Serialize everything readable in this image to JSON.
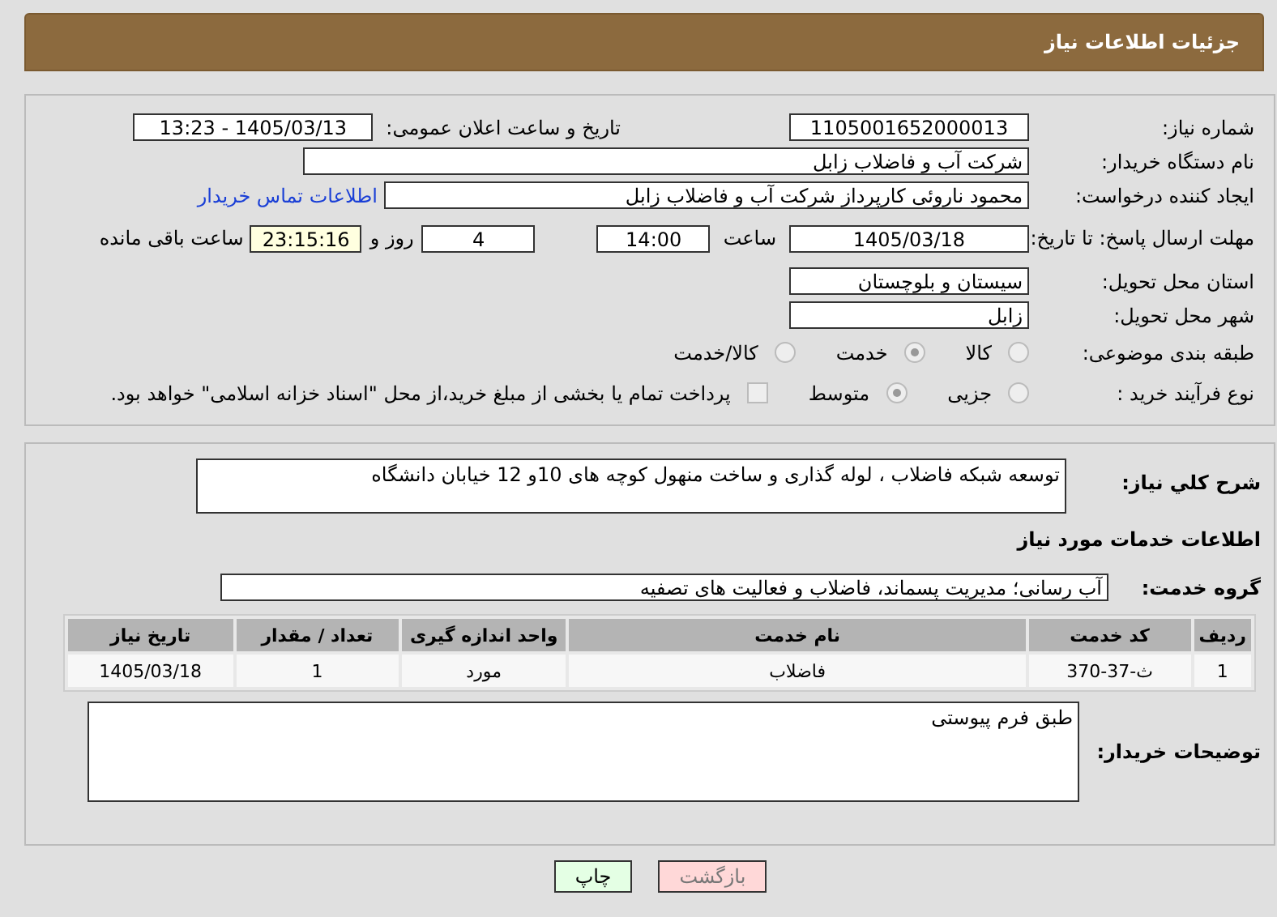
{
  "header": {
    "title": "جزئیات اطلاعات نیاز"
  },
  "details": {
    "need_number": {
      "label": "شماره نیاز:",
      "value": "1105001652000013"
    },
    "announce": {
      "label": "تاریخ و ساعت اعلان عمومی:",
      "value": "1405/03/13 - 13:23"
    },
    "buyer_org": {
      "label": "نام دستگاه خریدار:",
      "value": "شرکت آب و فاضلاب زابل"
    },
    "requester": {
      "label": "ایجاد کننده درخواست:",
      "value": "محمود ناروئی کارپرداز شرکت آب و فاضلاب زابل",
      "link": "اطلاعات تماس خریدار"
    },
    "deadline": {
      "label": "مهلت ارسال پاسخ: تا تاریخ:",
      "date": "1405/03/18",
      "time_label": "ساعت",
      "time": "14:00",
      "days": "4",
      "days_label": "روز و",
      "remaining": "23:15:16",
      "remaining_label": "ساعت باقی مانده"
    },
    "province": {
      "label": "استان محل تحویل:",
      "value": "سیستان و بلوچستان"
    },
    "city": {
      "label": "شهر محل تحویل:",
      "value": "زابل"
    },
    "category": {
      "label": "طبقه بندی موضوعی:",
      "options": [
        {
          "label": "کالا",
          "selected": false
        },
        {
          "label": "خدمت",
          "selected": true
        },
        {
          "label": "کالا/خدمت",
          "selected": false
        }
      ]
    },
    "process": {
      "label": "نوع فرآیند خرید :",
      "options": [
        {
          "label": "جزیی",
          "selected": false
        },
        {
          "label": "متوسط",
          "selected": true
        }
      ],
      "payment": {
        "label": "پرداخت تمام یا بخشی از مبلغ خرید،از محل \"اسناد خزانه اسلامی\" خواهد بود.",
        "checked": false
      }
    }
  },
  "description": {
    "label": "شرح کلي نياز:",
    "value": "توسعه شبکه فاضلاب ، لوله گذاری و ساخت منهول کوچه های 10و 12 خیابان دانشگاه"
  },
  "services_heading": "اطلاعات خدمات مورد نیاز",
  "service_group": {
    "label": "گروه خدمت:",
    "value": "آب رسانی؛ مدیریت پسماند، فاضلاب و فعالیت های تصفیه"
  },
  "table": {
    "columns": [
      "ردیف",
      "کد خدمت",
      "نام خدمت",
      "واحد اندازه گیری",
      "تعداد / مقدار",
      "تاریخ نیاز"
    ],
    "rows": [
      [
        "1",
        "ث-37-370",
        "فاضلاب",
        "مورد",
        "1",
        "1405/03/18"
      ]
    ]
  },
  "buyer_notes": {
    "label": "توضیحات خریدار:",
    "value": "طبق فرم پیوستی"
  },
  "buttons": [
    {
      "label": "بازگشت",
      "kind": "back"
    },
    {
      "label": "چاپ",
      "kind": "print"
    }
  ]
}
